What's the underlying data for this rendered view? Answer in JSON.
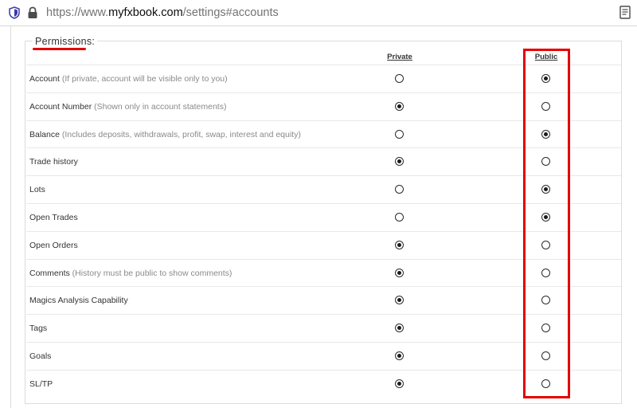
{
  "browser": {
    "url_prefix": "https://www.",
    "url_domain": "myfxbook.com",
    "url_path": "/settings#accounts"
  },
  "permissions": {
    "legend": "Permissions:",
    "columns": {
      "private": "Private",
      "public": "Public"
    },
    "rows": [
      {
        "label": "Account",
        "hint": " (If private, account will be visible only to you)",
        "selected": "public"
      },
      {
        "label": "Account Number",
        "hint": " (Shown only in account statements)",
        "selected": "private"
      },
      {
        "label": "Balance",
        "hint": " (Includes deposits, withdrawals, profit, swap, interest and equity)",
        "selected": "public"
      },
      {
        "label": "Trade history",
        "hint": "",
        "selected": "private"
      },
      {
        "label": "Lots",
        "hint": "",
        "selected": "public"
      },
      {
        "label": "Open Trades",
        "hint": "",
        "selected": "public"
      },
      {
        "label": "Open Orders",
        "hint": "",
        "selected": "private"
      },
      {
        "label": "Comments",
        "hint": " (History must be public to show comments)",
        "selected": "private"
      },
      {
        "label": "Magics Analysis Capability",
        "hint": "",
        "selected": "private"
      },
      {
        "label": "Tags",
        "hint": "",
        "selected": "private"
      },
      {
        "label": "Goals",
        "hint": "",
        "selected": "private"
      },
      {
        "label": "SL/TP",
        "hint": "",
        "selected": "private"
      }
    ]
  },
  "colors": {
    "annotation": "#e60000",
    "text": "#333333",
    "hint": "#8a8a8a"
  },
  "icons": {
    "tracking": "shield-icon",
    "security": "lock-icon",
    "reader": "reader-view-icon"
  }
}
